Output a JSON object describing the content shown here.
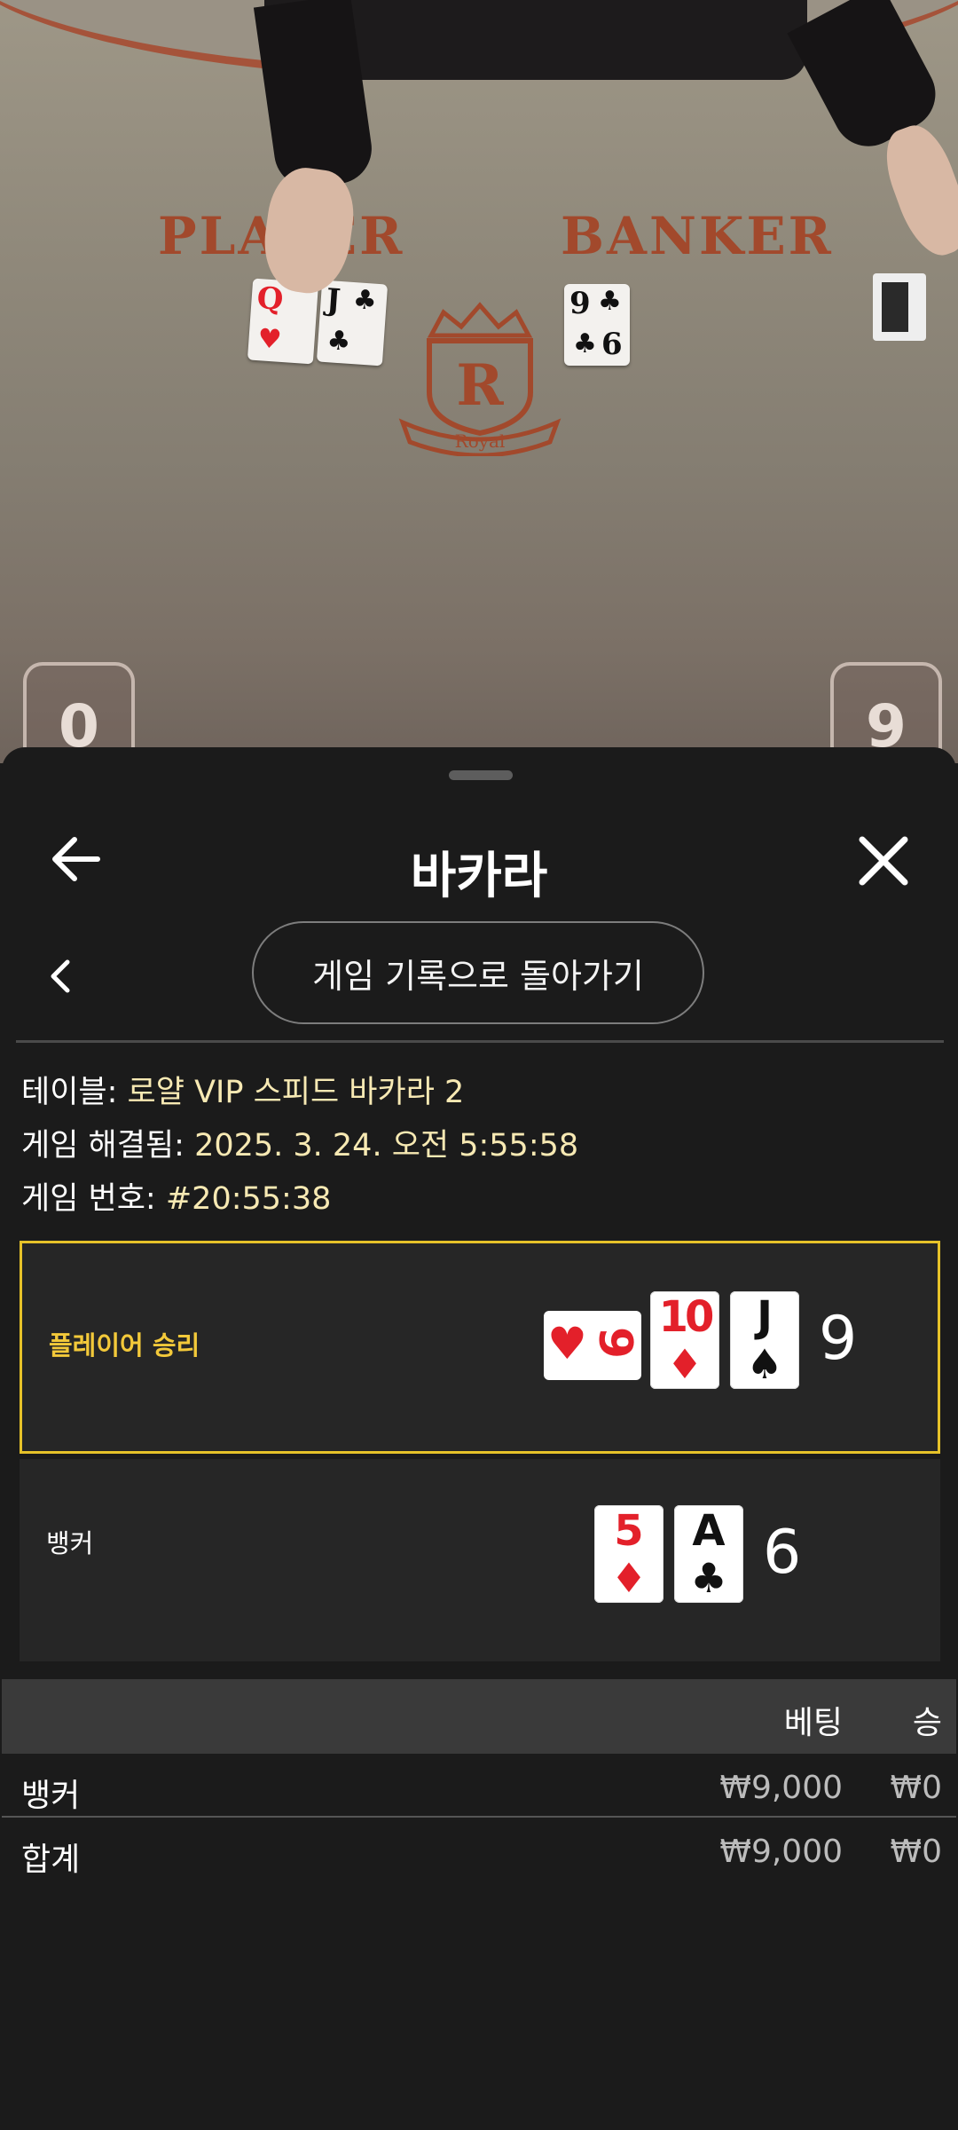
{
  "video": {
    "felt_player": "PLAYER",
    "felt_banker": "BANKER",
    "crest_letter": "R",
    "crest_text": "Royal",
    "player_score": "0",
    "banker_score": "9"
  },
  "sheet": {
    "title": "바카라",
    "back_button": "back-arrow-icon",
    "close_button": "close-icon",
    "back_to_history": "게임 기록으로 돌아가기"
  },
  "info": {
    "table_label": "테이블:",
    "table_value": "로얄 VIP 스피드 바카라 2",
    "resolved_label": "게임 해결됨:",
    "resolved_value": "2025. 3. 24. 오전 5:55:58",
    "number_label": "게임 번호:",
    "number_value": "#20:55:38"
  },
  "results": {
    "player": {
      "label": "플레이어 승리",
      "cards": [
        {
          "rank": "9",
          "suit": "♥"
        },
        {
          "rank": "10",
          "suit": "♦"
        },
        {
          "rank": "J",
          "suit": "♠"
        }
      ],
      "score": "9",
      "highlight_color": "#e6c229"
    },
    "banker": {
      "label": "뱅커",
      "cards": [
        {
          "rank": "5",
          "suit": "♦"
        },
        {
          "rank": "A",
          "suit": "♣"
        }
      ],
      "score": "6"
    }
  },
  "bets": {
    "col_bet": "베팅",
    "col_win": "승",
    "rows": [
      {
        "name": "뱅커",
        "bet": "₩9,000",
        "win": "₩0"
      },
      {
        "name": "합계",
        "bet": "₩9,000",
        "win": "₩0"
      }
    ]
  }
}
